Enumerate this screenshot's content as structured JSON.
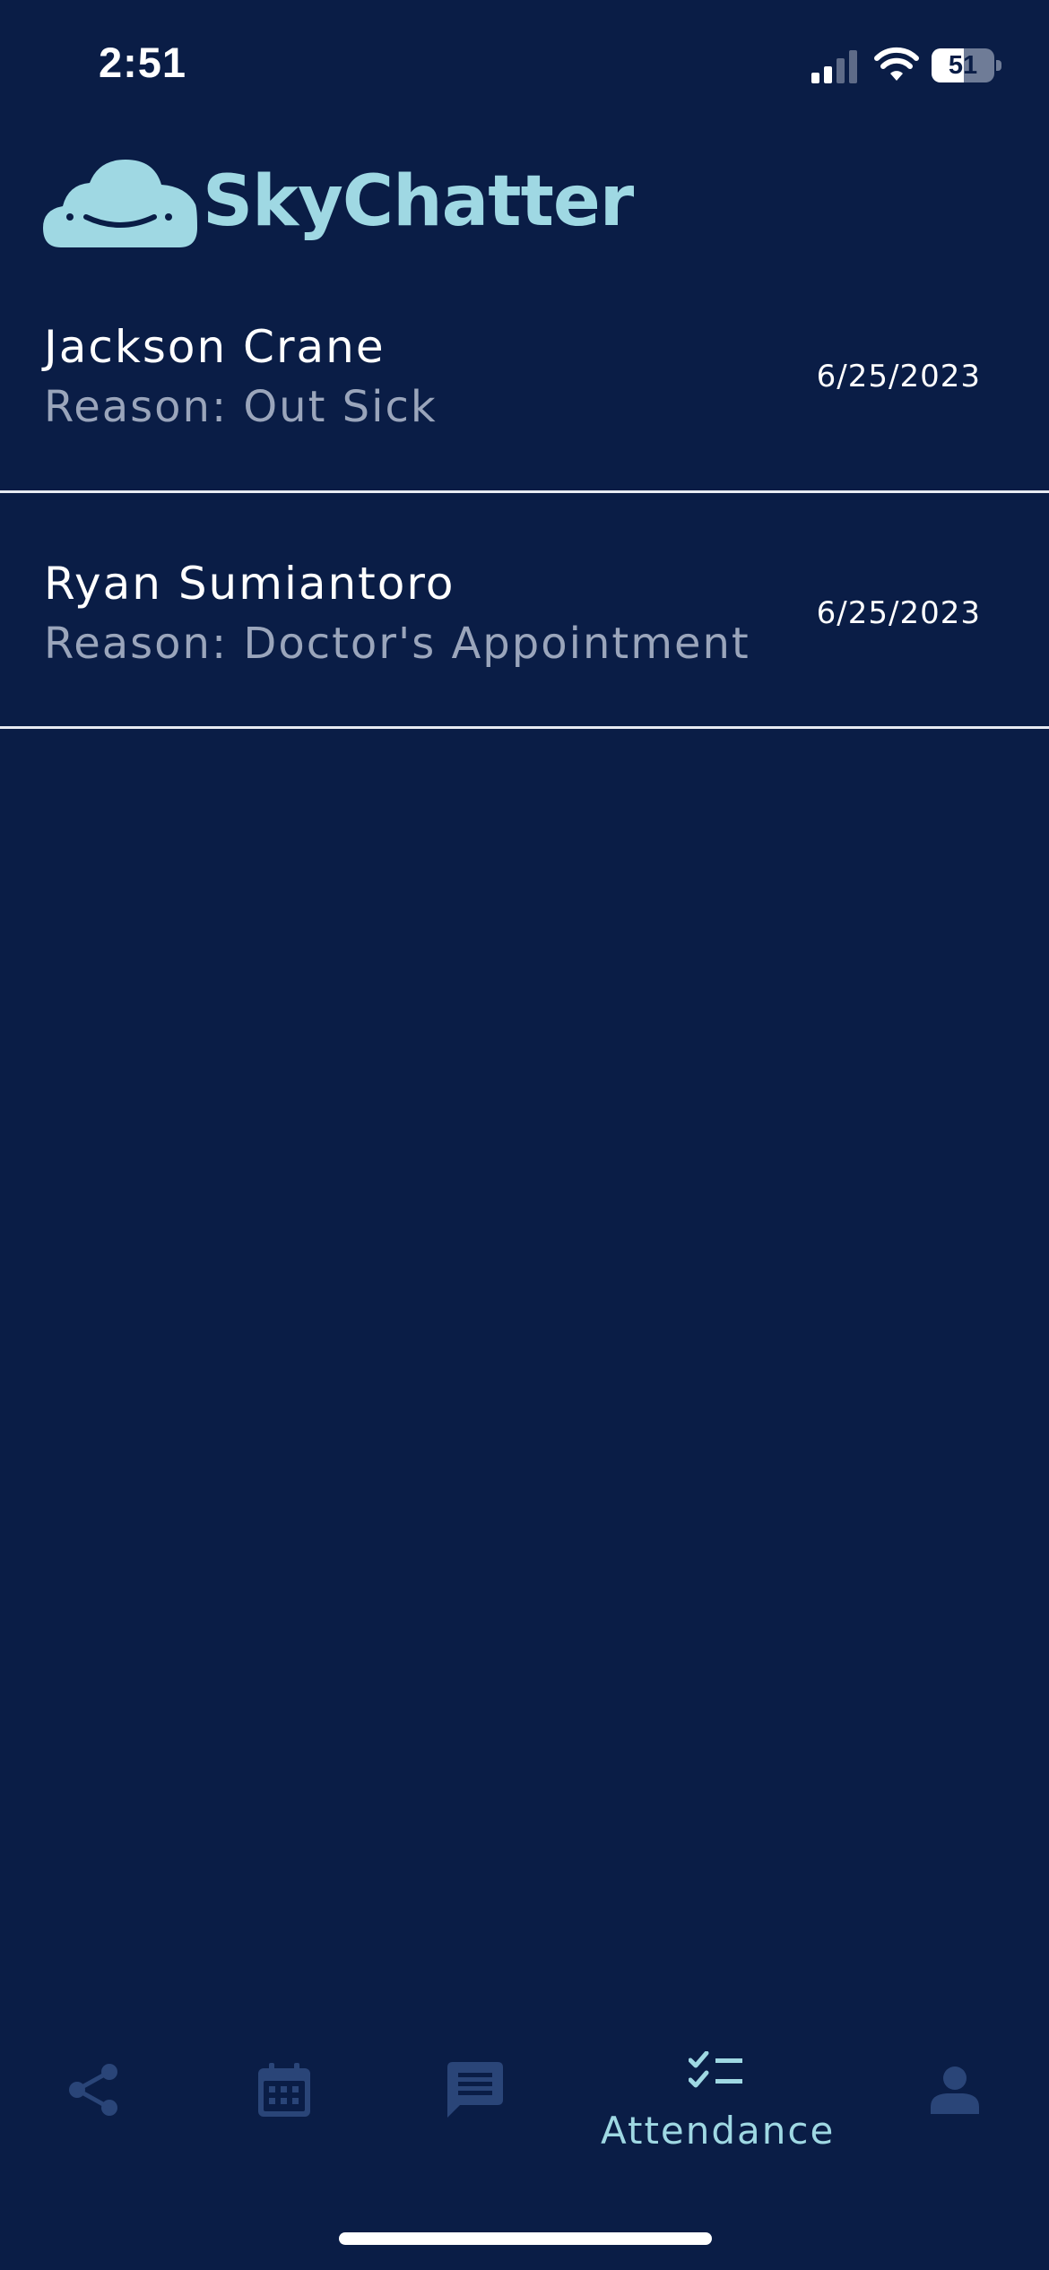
{
  "status_bar": {
    "time": "2:51",
    "battery_level": "51",
    "battery_fraction": 0.51
  },
  "header": {
    "app_name": "SkyChatter",
    "logo_icon": "smiling-cloud-icon"
  },
  "absences": [
    {
      "name": "Jackson Crane",
      "reason": "Reason: Out Sick",
      "date": "6/25/2023"
    },
    {
      "name": "Ryan Sumiantoro",
      "reason": "Reason: Doctor's Appointment",
      "date": "6/25/2023"
    }
  ],
  "bottom_nav": {
    "items": [
      {
        "icon": "share-icon",
        "label": "",
        "active": false
      },
      {
        "icon": "calendar-icon",
        "label": "",
        "active": false
      },
      {
        "icon": "chat-icon",
        "label": "",
        "active": false
      },
      {
        "icon": "checklist-icon",
        "label": "Attendance",
        "active": true
      },
      {
        "icon": "person-icon",
        "label": "",
        "active": false
      }
    ]
  },
  "colors": {
    "background": "#0a1d46",
    "accent": "#9fd8e3",
    "inactive_icon": "#2a4578",
    "secondary_text": "#9aa5bb",
    "divider": "#e6eaf2"
  }
}
